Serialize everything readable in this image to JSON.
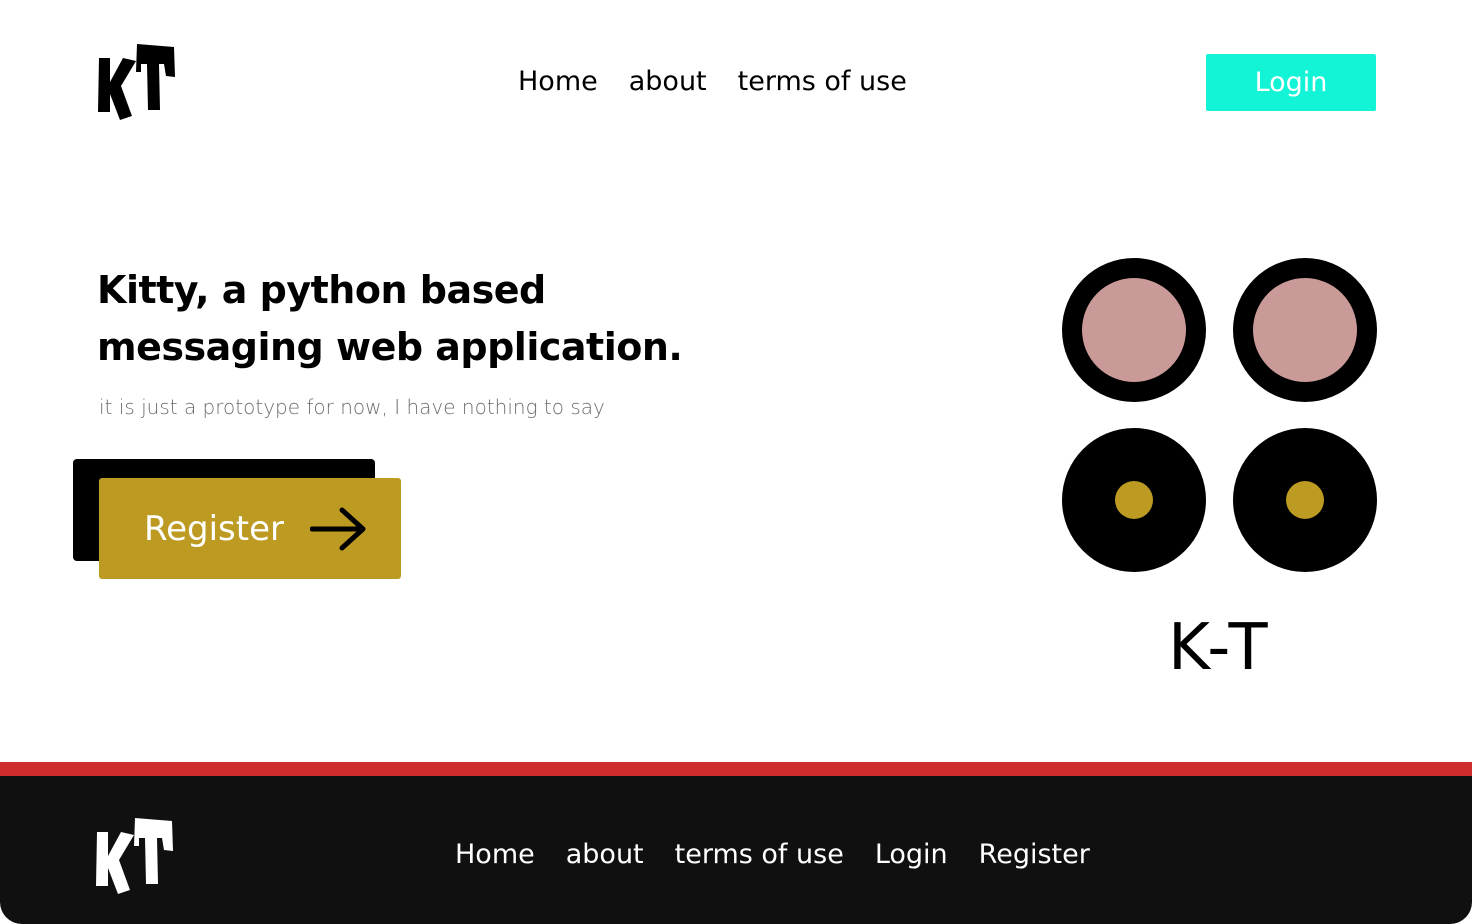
{
  "header": {
    "logo_icon": "kt-logo-icon",
    "nav": [
      {
        "label": "Home"
      },
      {
        "label": "about"
      },
      {
        "label": "terms of use"
      }
    ],
    "login_label": "Login"
  },
  "hero": {
    "title_line1": "Kitty, a python based",
    "title_line2": "messaging  web application.",
    "subtitle": "it is just a prototype for now, I have nothing to say",
    "register_label": "Register",
    "register_icon": "arrow-right-icon",
    "art_caption": "K-T"
  },
  "footer": {
    "logo_icon": "kt-logo-icon",
    "nav": [
      {
        "label": "Home"
      },
      {
        "label": "about"
      },
      {
        "label": "terms of use"
      },
      {
        "label": "Login"
      },
      {
        "label": "Register"
      }
    ]
  },
  "colors": {
    "accent_login": "#13f4d6",
    "accent_register": "#bd9a22",
    "pink_eye": "#c99a98",
    "footer_bg": "#101010",
    "footer_strip": "#cf2c2c"
  }
}
